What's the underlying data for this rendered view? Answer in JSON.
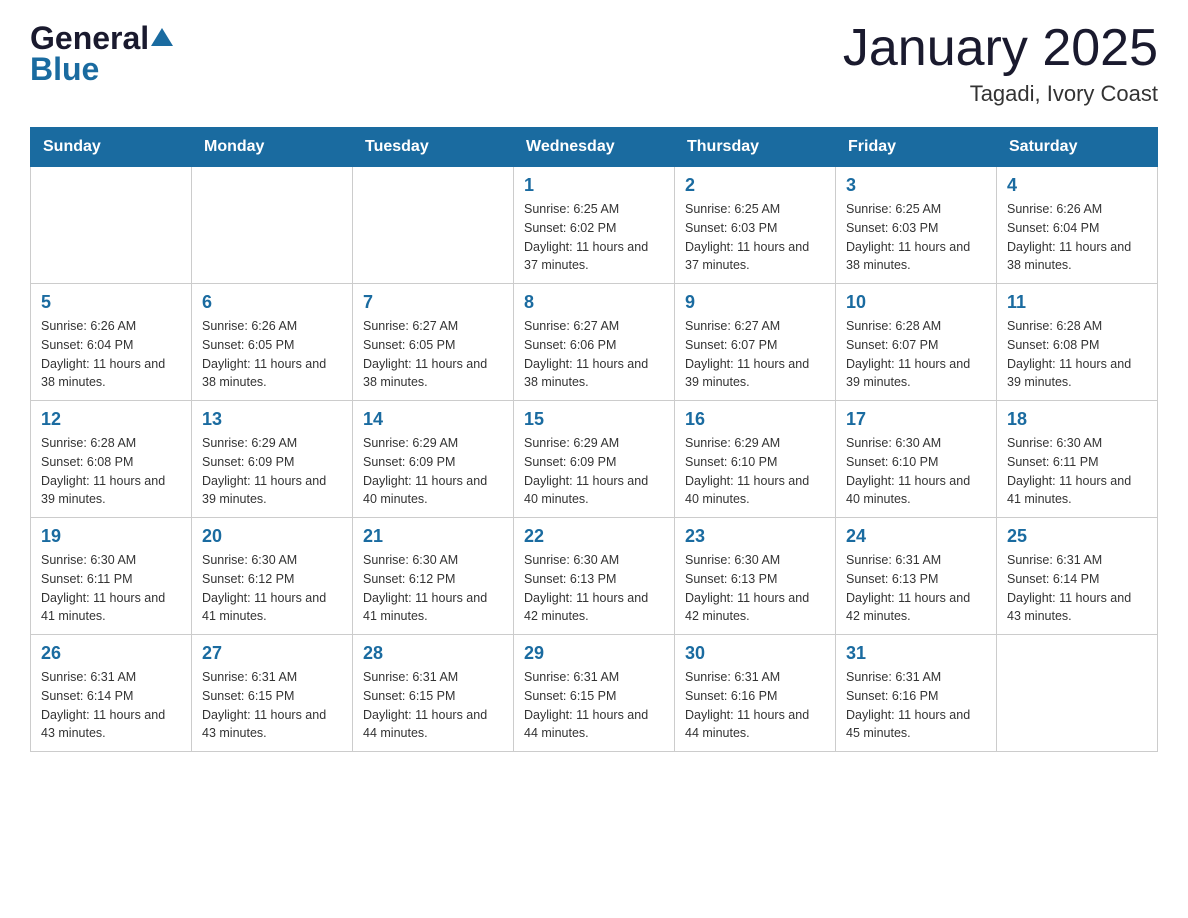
{
  "header": {
    "logo_general": "General",
    "logo_blue": "Blue",
    "title": "January 2025",
    "subtitle": "Tagadi, Ivory Coast"
  },
  "calendar": {
    "days_of_week": [
      "Sunday",
      "Monday",
      "Tuesday",
      "Wednesday",
      "Thursday",
      "Friday",
      "Saturday"
    ],
    "weeks": [
      [
        {
          "day": "",
          "info": ""
        },
        {
          "day": "",
          "info": ""
        },
        {
          "day": "",
          "info": ""
        },
        {
          "day": "1",
          "info": "Sunrise: 6:25 AM\nSunset: 6:02 PM\nDaylight: 11 hours and 37 minutes."
        },
        {
          "day": "2",
          "info": "Sunrise: 6:25 AM\nSunset: 6:03 PM\nDaylight: 11 hours and 37 minutes."
        },
        {
          "day": "3",
          "info": "Sunrise: 6:25 AM\nSunset: 6:03 PM\nDaylight: 11 hours and 38 minutes."
        },
        {
          "day": "4",
          "info": "Sunrise: 6:26 AM\nSunset: 6:04 PM\nDaylight: 11 hours and 38 minutes."
        }
      ],
      [
        {
          "day": "5",
          "info": "Sunrise: 6:26 AM\nSunset: 6:04 PM\nDaylight: 11 hours and 38 minutes."
        },
        {
          "day": "6",
          "info": "Sunrise: 6:26 AM\nSunset: 6:05 PM\nDaylight: 11 hours and 38 minutes."
        },
        {
          "day": "7",
          "info": "Sunrise: 6:27 AM\nSunset: 6:05 PM\nDaylight: 11 hours and 38 minutes."
        },
        {
          "day": "8",
          "info": "Sunrise: 6:27 AM\nSunset: 6:06 PM\nDaylight: 11 hours and 38 minutes."
        },
        {
          "day": "9",
          "info": "Sunrise: 6:27 AM\nSunset: 6:07 PM\nDaylight: 11 hours and 39 minutes."
        },
        {
          "day": "10",
          "info": "Sunrise: 6:28 AM\nSunset: 6:07 PM\nDaylight: 11 hours and 39 minutes."
        },
        {
          "day": "11",
          "info": "Sunrise: 6:28 AM\nSunset: 6:08 PM\nDaylight: 11 hours and 39 minutes."
        }
      ],
      [
        {
          "day": "12",
          "info": "Sunrise: 6:28 AM\nSunset: 6:08 PM\nDaylight: 11 hours and 39 minutes."
        },
        {
          "day": "13",
          "info": "Sunrise: 6:29 AM\nSunset: 6:09 PM\nDaylight: 11 hours and 39 minutes."
        },
        {
          "day": "14",
          "info": "Sunrise: 6:29 AM\nSunset: 6:09 PM\nDaylight: 11 hours and 40 minutes."
        },
        {
          "day": "15",
          "info": "Sunrise: 6:29 AM\nSunset: 6:09 PM\nDaylight: 11 hours and 40 minutes."
        },
        {
          "day": "16",
          "info": "Sunrise: 6:29 AM\nSunset: 6:10 PM\nDaylight: 11 hours and 40 minutes."
        },
        {
          "day": "17",
          "info": "Sunrise: 6:30 AM\nSunset: 6:10 PM\nDaylight: 11 hours and 40 minutes."
        },
        {
          "day": "18",
          "info": "Sunrise: 6:30 AM\nSunset: 6:11 PM\nDaylight: 11 hours and 41 minutes."
        }
      ],
      [
        {
          "day": "19",
          "info": "Sunrise: 6:30 AM\nSunset: 6:11 PM\nDaylight: 11 hours and 41 minutes."
        },
        {
          "day": "20",
          "info": "Sunrise: 6:30 AM\nSunset: 6:12 PM\nDaylight: 11 hours and 41 minutes."
        },
        {
          "day": "21",
          "info": "Sunrise: 6:30 AM\nSunset: 6:12 PM\nDaylight: 11 hours and 41 minutes."
        },
        {
          "day": "22",
          "info": "Sunrise: 6:30 AM\nSunset: 6:13 PM\nDaylight: 11 hours and 42 minutes."
        },
        {
          "day": "23",
          "info": "Sunrise: 6:30 AM\nSunset: 6:13 PM\nDaylight: 11 hours and 42 minutes."
        },
        {
          "day": "24",
          "info": "Sunrise: 6:31 AM\nSunset: 6:13 PM\nDaylight: 11 hours and 42 minutes."
        },
        {
          "day": "25",
          "info": "Sunrise: 6:31 AM\nSunset: 6:14 PM\nDaylight: 11 hours and 43 minutes."
        }
      ],
      [
        {
          "day": "26",
          "info": "Sunrise: 6:31 AM\nSunset: 6:14 PM\nDaylight: 11 hours and 43 minutes."
        },
        {
          "day": "27",
          "info": "Sunrise: 6:31 AM\nSunset: 6:15 PM\nDaylight: 11 hours and 43 minutes."
        },
        {
          "day": "28",
          "info": "Sunrise: 6:31 AM\nSunset: 6:15 PM\nDaylight: 11 hours and 44 minutes."
        },
        {
          "day": "29",
          "info": "Sunrise: 6:31 AM\nSunset: 6:15 PM\nDaylight: 11 hours and 44 minutes."
        },
        {
          "day": "30",
          "info": "Sunrise: 6:31 AM\nSunset: 6:16 PM\nDaylight: 11 hours and 44 minutes."
        },
        {
          "day": "31",
          "info": "Sunrise: 6:31 AM\nSunset: 6:16 PM\nDaylight: 11 hours and 45 minutes."
        },
        {
          "day": "",
          "info": ""
        }
      ]
    ]
  }
}
